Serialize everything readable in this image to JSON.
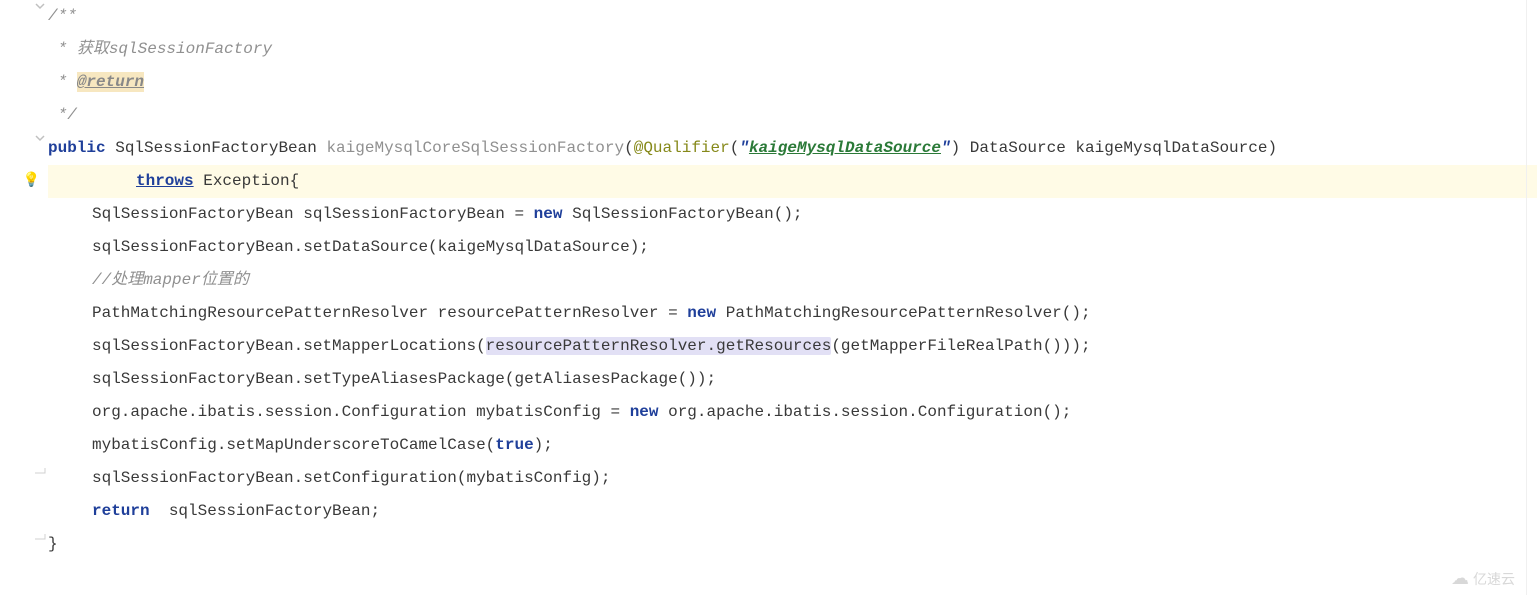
{
  "lines": {
    "l1": "/**",
    "l2_prefix": " * ",
    "l2_text": "获取sqlSessionFactory",
    "l3_prefix": " * ",
    "l3_tag": "@return",
    "l4": " */",
    "l5_public": "public",
    "l5_type": " SqlSessionFactoryBean ",
    "l5_method": "kaigeMysqlCoreSqlSessionFactory",
    "l5_paren_open": "(",
    "l5_annotation": "@Qualifier",
    "l5_ann_open": "(",
    "l5_q1": "\"",
    "l5_str": "kaigeMysqlDataSource",
    "l5_q2": "\"",
    "l5_ann_close": ")",
    "l5_param": " DataSource kaigeMysqlDataSource)",
    "l6_throws": "throws",
    "l6_rest": " Exception{",
    "l7_a": "SqlSessionFactoryBean sqlSessionFactoryBean = ",
    "l7_new": "new",
    "l7_b": " SqlSessionFactoryBean();",
    "l8": "sqlSessionFactoryBean.setDataSource(kaigeMysqlDataSource);",
    "l9": "//处理mapper位置的",
    "l10_a": "PathMatchingResourcePatternResolver resourcePatternResolver = ",
    "l10_new": "new",
    "l10_b": " PathMatchingResourcePatternResolver();",
    "l11_a": "sqlSessionFactoryBean.setMapperLocations(",
    "l11_hl": "resourcePatternResolver.getResources",
    "l11_b": "(getMapperFileRealPath()));",
    "l12": "sqlSessionFactoryBean.setTypeAliasesPackage(getAliasesPackage());",
    "l13_a": "org.apache.ibatis.session.Configuration mybatisConfig = ",
    "l13_new": "new",
    "l13_b": " org.apache.ibatis.session.Configuration();",
    "l14_a": "mybatisConfig.setMapUnderscoreToCamelCase(",
    "l14_true": "true",
    "l14_b": ");",
    "l15": "sqlSessionFactoryBean.setConfiguration(mybatisConfig);",
    "l16_return": "return",
    "l16_rest": "  sqlSessionFactoryBean;",
    "l17": "}"
  },
  "watermark": "亿速云"
}
